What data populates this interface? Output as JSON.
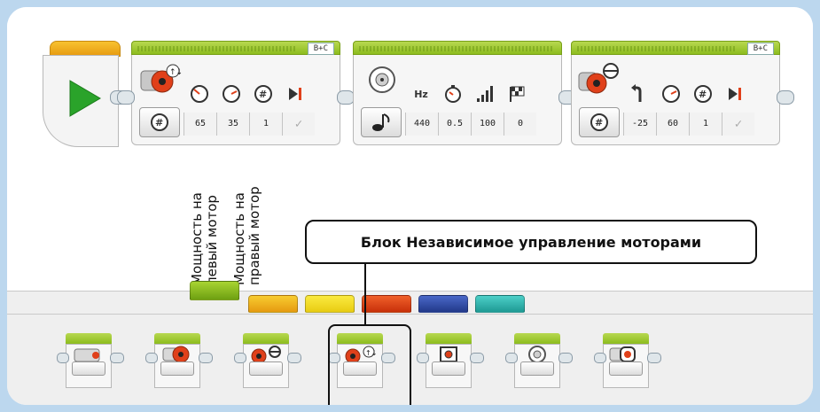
{
  "colors": {
    "start_play": "#2aa32a",
    "action_header": "#a0c83c",
    "motor_red": "#e0401a",
    "palette_tabs": [
      "#8cc21e",
      "#f2b418",
      "#f4e01c",
      "#e0400e",
      "#2e4fa8",
      "#2ab7b0"
    ]
  },
  "start_block": {
    "icon": "play-icon"
  },
  "blocks": [
    {
      "name": "tank-block",
      "port": "B+C",
      "icon": "independent-motor-icon",
      "mode_icon": "rotations-count-icon",
      "param_icons": [
        "power-gauge-icon",
        "power-gauge-icon",
        "rotations-count-icon",
        "brake-icon"
      ],
      "values": [
        "65",
        "35",
        "1",
        "✓"
      ]
    },
    {
      "name": "sound-block",
      "port": "",
      "icon": "speaker-icon",
      "mode_icon": "note-icon",
      "param_labels": [
        "Hz",
        "",
        "",
        ""
      ],
      "param_icons": [
        "hz-label",
        "timer-icon",
        "volume-bars-icon",
        "flag-icon"
      ],
      "values": [
        "440",
        "0.5",
        "100",
        "0"
      ]
    },
    {
      "name": "steering-block",
      "port": "B+C",
      "icon": "steering-motor-icon",
      "mode_icon": "rotations-count-icon",
      "param_icons": [
        "steering-arrow-icon",
        "power-gauge-icon",
        "rotations-count-icon",
        "brake-icon"
      ],
      "values": [
        "-25",
        "60",
        "1",
        "✓"
      ]
    }
  ],
  "annotations": {
    "left_motor": "Мощность на\nлевый мотор",
    "right_motor": "Мощность на\nправый мотор"
  },
  "callout": {
    "text": "Блок Независимое управление моторами"
  },
  "palette_blocks": [
    {
      "name": "palette-medium-motor",
      "icon": "medium-motor-icon"
    },
    {
      "name": "palette-large-motor",
      "icon": "large-motor-icon"
    },
    {
      "name": "palette-move-steering",
      "icon": "steering-motor-icon"
    },
    {
      "name": "palette-move-tank",
      "icon": "independent-motor-icon",
      "selected": true
    },
    {
      "name": "palette-display",
      "icon": "display-icon"
    },
    {
      "name": "palette-sound",
      "icon": "speaker-icon"
    },
    {
      "name": "palette-brick-status-light",
      "icon": "status-light-icon"
    }
  ]
}
